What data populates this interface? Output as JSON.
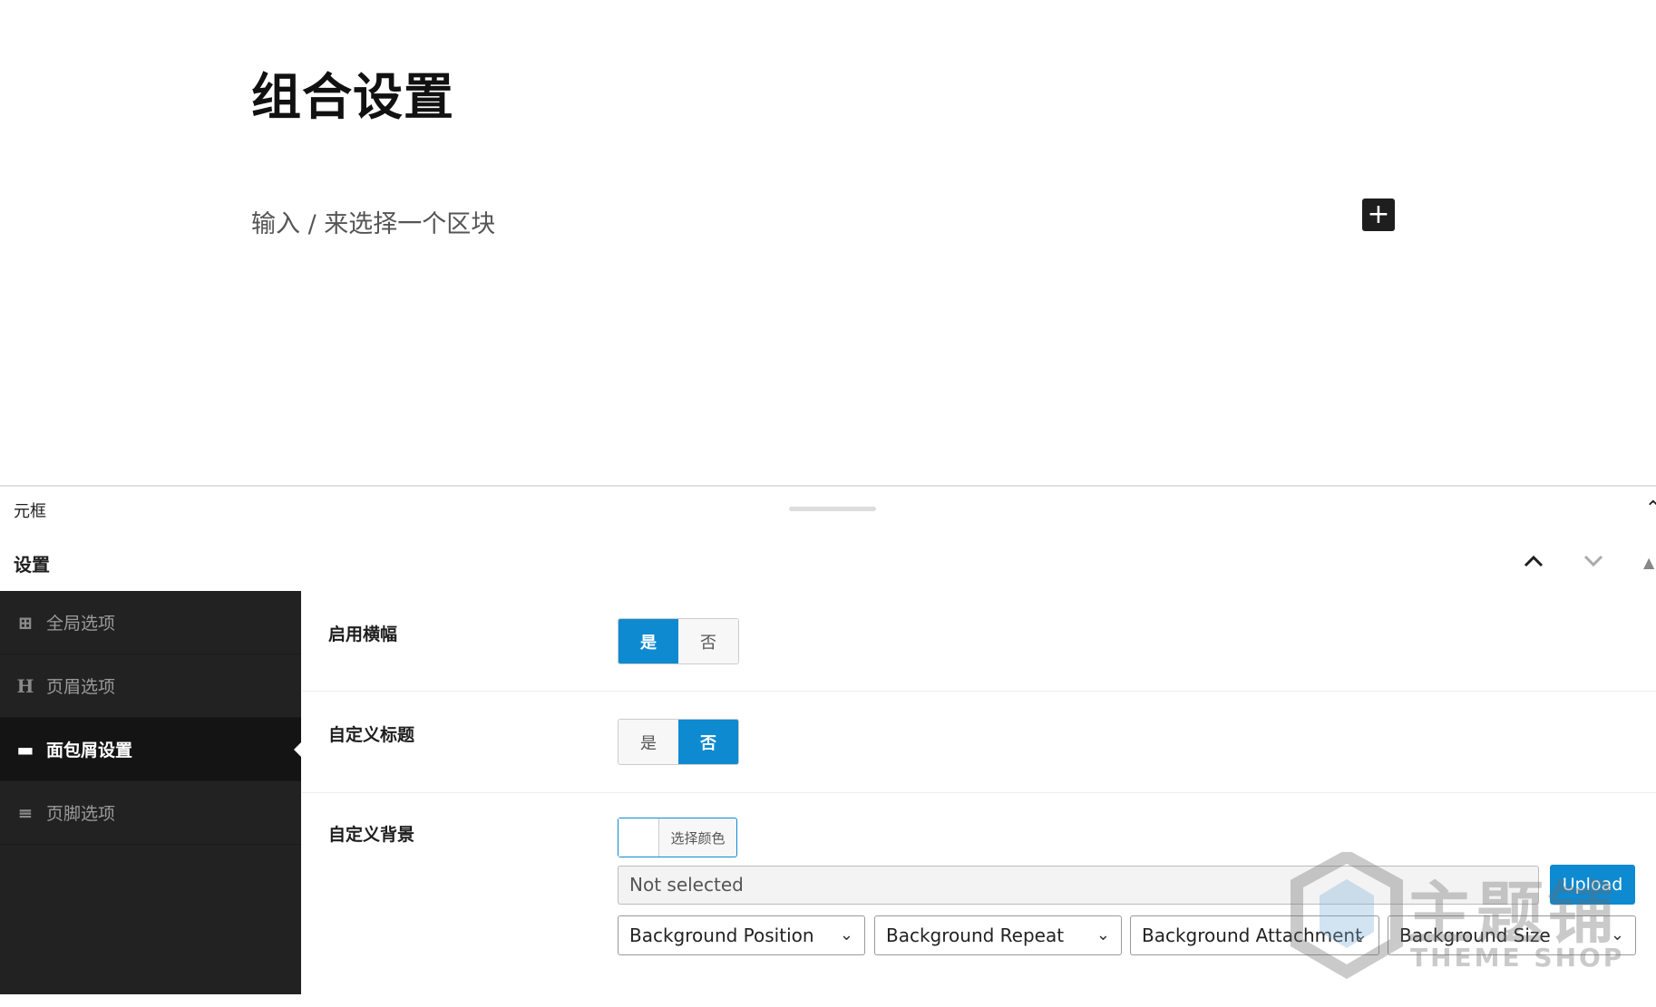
{
  "editor": {
    "title": "组合设置",
    "placeholder": "输入 / 来选择一个区块",
    "inserter_icon": "+"
  },
  "meta_box": {
    "header": "元框",
    "caret": "⌃"
  },
  "settings": {
    "title": "设置",
    "up_icon": "⌃",
    "down_icon": "⌄",
    "tri_icon": "▲"
  },
  "sidebar": {
    "items": [
      {
        "label": "全局选项",
        "icon": "grid-icon",
        "glyph": "⊞"
      },
      {
        "label": "页眉选项",
        "icon": "header-icon",
        "glyph": "H"
      },
      {
        "label": "面包屑设置",
        "icon": "card-icon",
        "glyph": "▬"
      },
      {
        "label": "页脚选项",
        "icon": "align-icon",
        "glyph": "≡"
      }
    ],
    "active_index": 2
  },
  "fields": {
    "banner": {
      "label": "启用横幅",
      "yes": "是",
      "no": "否",
      "selected": "yes"
    },
    "custom_title": {
      "label": "自定义标题",
      "yes": "是",
      "no": "否",
      "selected": "no"
    },
    "custom_bg": {
      "label": "自定义背景",
      "color_button": "选择颜色",
      "file_value": "Not selected",
      "upload": "Upload",
      "selects": [
        "Background Position",
        "Background Repeat",
        "Background Attachment",
        "Background Size"
      ],
      "select_arrow": "⌄"
    }
  },
  "colors": {
    "accent": "#0e8ad1",
    "sidebar_bg": "#222222",
    "sidebar_active": "#141414"
  },
  "watermark": {
    "main": "主题铺",
    "sub": "THEME SHOP"
  }
}
